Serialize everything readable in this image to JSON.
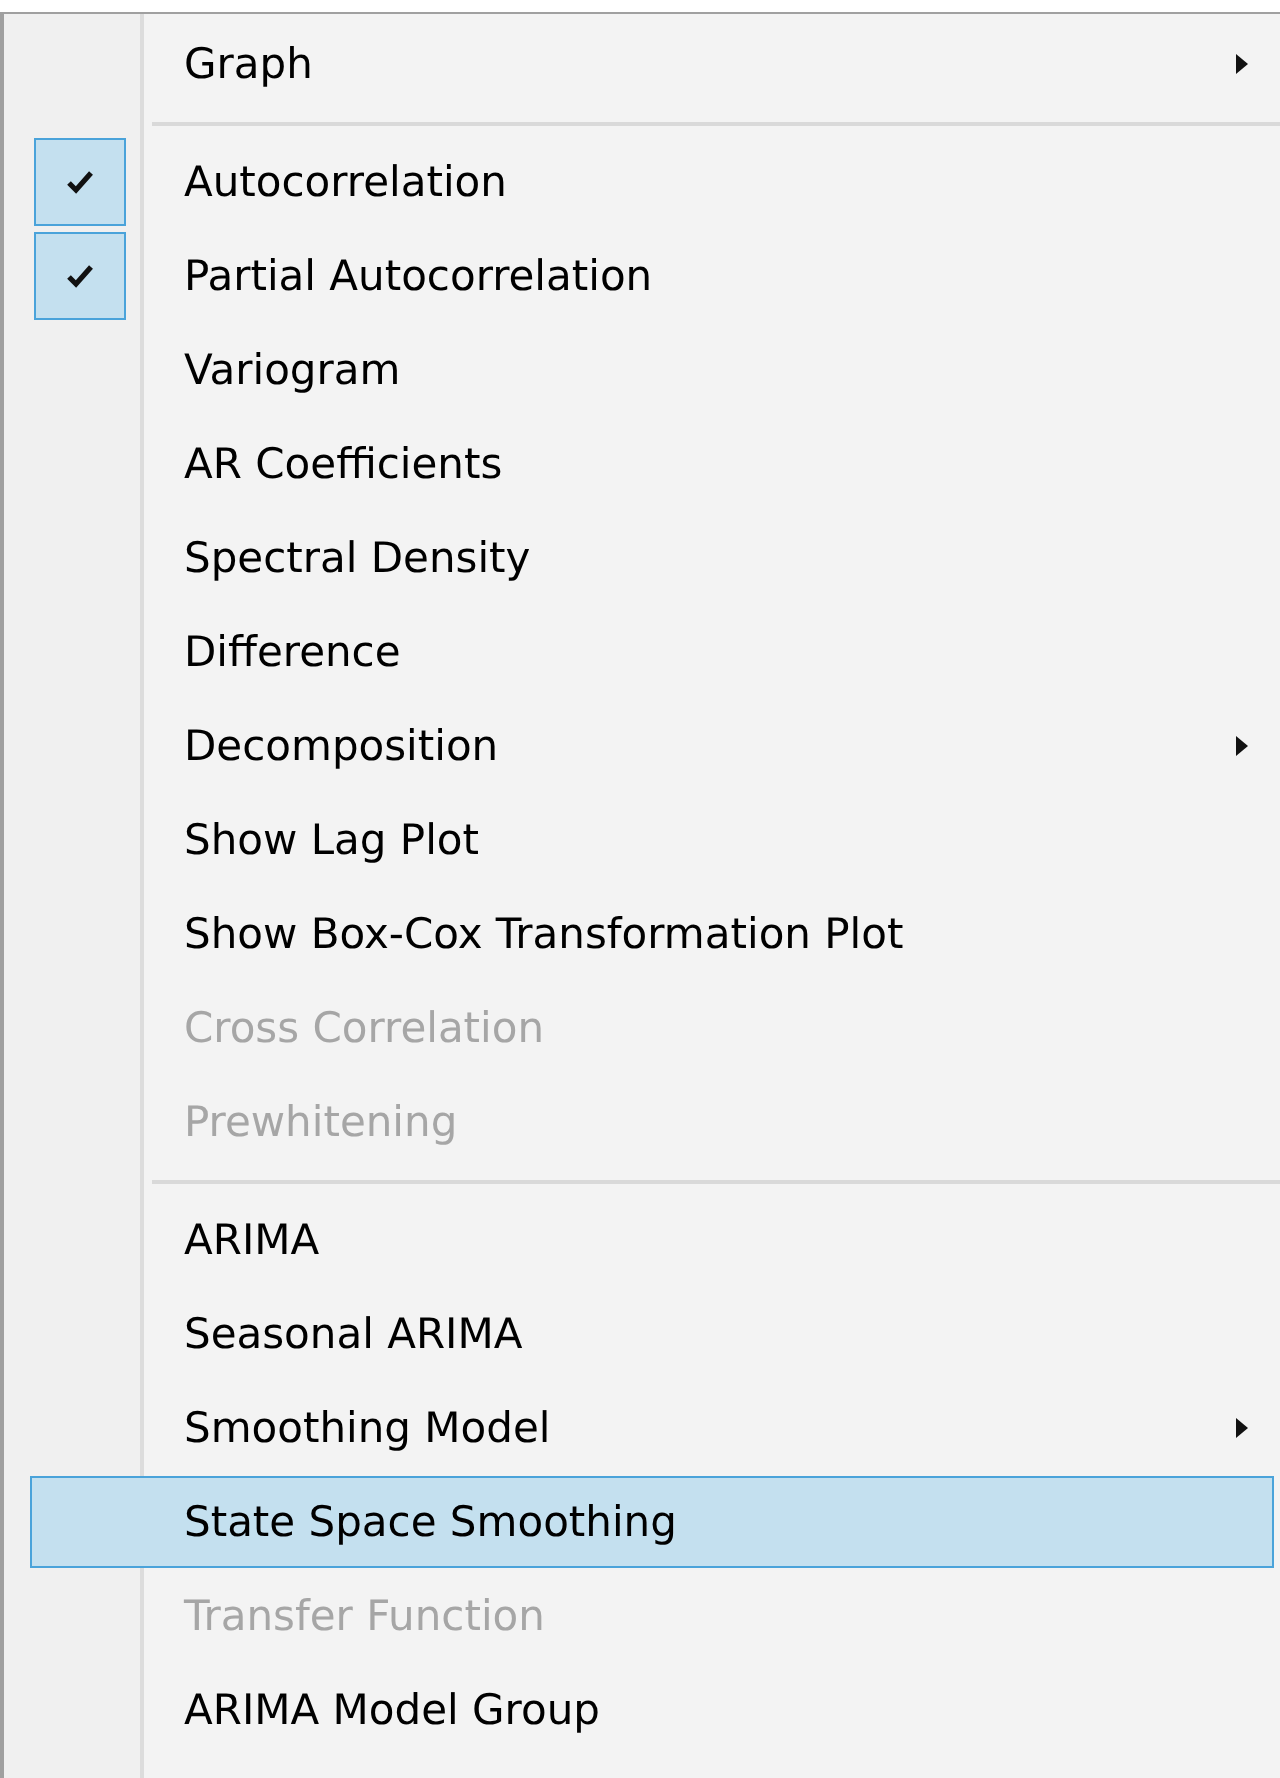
{
  "menu": {
    "items": [
      {
        "kind": "item",
        "label": "Graph",
        "checked": false,
        "disabled": false,
        "submenu": true,
        "selected": false
      },
      {
        "kind": "separator"
      },
      {
        "kind": "item",
        "label": "Autocorrelation",
        "checked": true,
        "disabled": false,
        "submenu": false,
        "selected": false
      },
      {
        "kind": "item",
        "label": "Partial Autocorrelation",
        "checked": true,
        "disabled": false,
        "submenu": false,
        "selected": false
      },
      {
        "kind": "item",
        "label": "Variogram",
        "checked": false,
        "disabled": false,
        "submenu": false,
        "selected": false
      },
      {
        "kind": "item",
        "label": "AR Coefficients",
        "checked": false,
        "disabled": false,
        "submenu": false,
        "selected": false
      },
      {
        "kind": "item",
        "label": "Spectral Density",
        "checked": false,
        "disabled": false,
        "submenu": false,
        "selected": false
      },
      {
        "kind": "item",
        "label": "Difference",
        "checked": false,
        "disabled": false,
        "submenu": false,
        "selected": false
      },
      {
        "kind": "item",
        "label": "Decomposition",
        "checked": false,
        "disabled": false,
        "submenu": true,
        "selected": false
      },
      {
        "kind": "item",
        "label": "Show Lag Plot",
        "checked": false,
        "disabled": false,
        "submenu": false,
        "selected": false
      },
      {
        "kind": "item",
        "label": "Show Box-Cox Transformation Plot",
        "checked": false,
        "disabled": false,
        "submenu": false,
        "selected": false
      },
      {
        "kind": "item",
        "label": "Cross Correlation",
        "checked": false,
        "disabled": true,
        "submenu": false,
        "selected": false
      },
      {
        "kind": "item",
        "label": "Prewhitening",
        "checked": false,
        "disabled": true,
        "submenu": false,
        "selected": false
      },
      {
        "kind": "separator"
      },
      {
        "kind": "item",
        "label": "ARIMA",
        "checked": false,
        "disabled": false,
        "submenu": false,
        "selected": false
      },
      {
        "kind": "item",
        "label": "Seasonal ARIMA",
        "checked": false,
        "disabled": false,
        "submenu": false,
        "selected": false
      },
      {
        "kind": "item",
        "label": "Smoothing Model",
        "checked": false,
        "disabled": false,
        "submenu": true,
        "selected": false
      },
      {
        "kind": "item",
        "label": "State Space Smoothing",
        "checked": false,
        "disabled": false,
        "submenu": false,
        "selected": true
      },
      {
        "kind": "item",
        "label": "Transfer Function",
        "checked": false,
        "disabled": true,
        "submenu": false,
        "selected": false
      },
      {
        "kind": "item",
        "label": "ARIMA Model Group",
        "checked": false,
        "disabled": false,
        "submenu": false,
        "selected": false
      }
    ]
  }
}
